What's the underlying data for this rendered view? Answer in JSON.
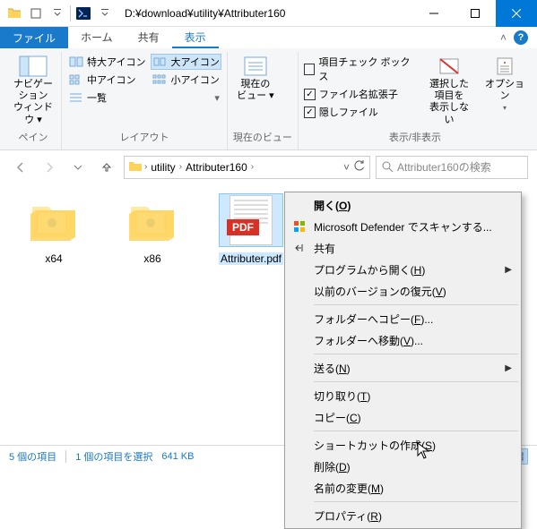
{
  "window": {
    "title": "D:¥download¥utility¥Attributer160"
  },
  "tabs": {
    "file": "ファイル",
    "home": "ホーム",
    "share": "共有",
    "view": "表示"
  },
  "ribbon": {
    "pane_group": "ペイン",
    "nav_pane": "ナビゲーション\nウィンドウ ▾",
    "layout_group": "レイアウト",
    "size_extra_large": "特大アイコン",
    "size_large": "大アイコン",
    "size_medium": "中アイコン",
    "size_small": "小アイコン",
    "size_list": "一覧",
    "current_view_group": "現在のビュー",
    "current_view": "現在の\nビュー ▾",
    "show_hide_group": "表示/非表示",
    "chk_item_check": "項目チェック ボックス",
    "chk_ext": "ファイル名拡張子",
    "chk_hidden": "隠しファイル",
    "hide_selected": "選択した項目を\n表示しない",
    "options": "オプション"
  },
  "breadcrumb": {
    "seg1": "utility",
    "seg2": "Attributer160"
  },
  "search": {
    "placeholder": "Attributer160の検索"
  },
  "files": {
    "f0": "x64",
    "f1": "x86",
    "f2": "Attributer.pdf",
    "pdf_badge": "PDF"
  },
  "statusbar": {
    "count": "5 個の項目",
    "selected": "1 個の項目を選択",
    "size": "641 KB"
  },
  "ctx": {
    "open": "開く(O)",
    "defender": "Microsoft Defender でスキャンする...",
    "share": "共有",
    "open_with": "プログラムから開く(H)",
    "prev_ver": "以前のバージョンの復元(V)",
    "copy_to_folder": "フォルダーへコピー(F)...",
    "move_to_folder": "フォルダーへ移動(V)...",
    "send_to": "送る(N)",
    "cut": "切り取り(T)",
    "copy": "コピー(C)",
    "shortcut": "ショートカットの作成(S)",
    "delete": "削除(D)",
    "rename": "名前の変更(M)",
    "properties": "プロパティ(R)"
  }
}
